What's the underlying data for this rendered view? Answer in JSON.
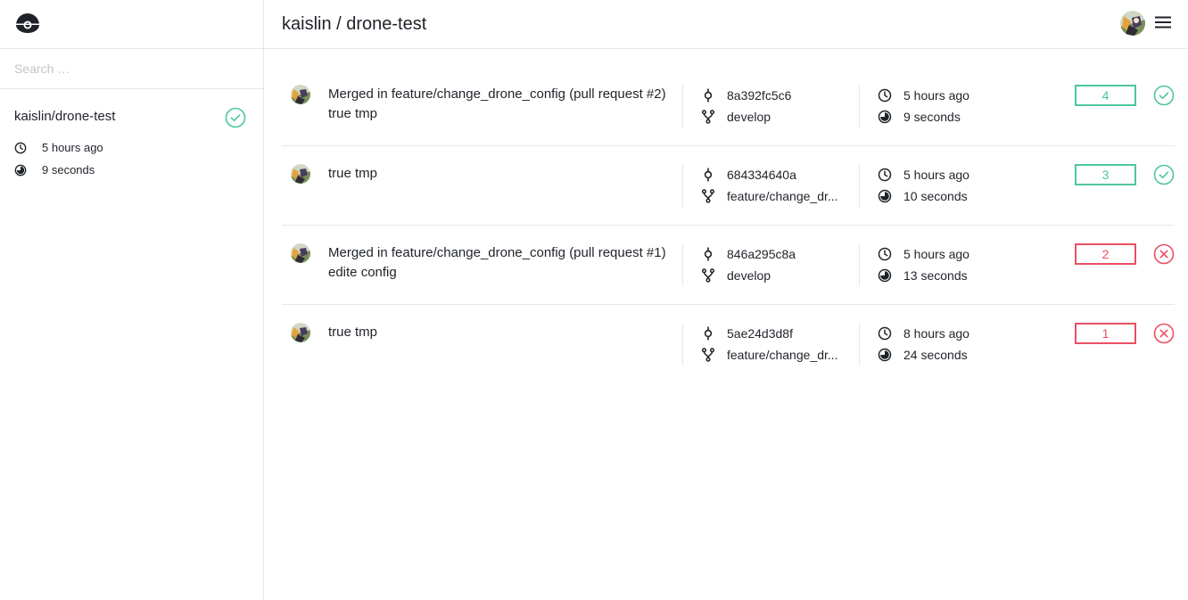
{
  "sidebar": {
    "search_placeholder": "Search …",
    "repo": {
      "name": "kaislin/drone-test",
      "status": "success",
      "time_ago": "5 hours ago",
      "duration": "9 seconds"
    }
  },
  "header": {
    "title": "kaislin / drone-test"
  },
  "builds": [
    {
      "message": "Merged in feature/change_drone_config (pull request #2) true tmp",
      "commit": "8a392fc5c6",
      "branch": "develop",
      "time_ago": "5 hours ago",
      "duration": "9 seconds",
      "number": "4",
      "status": "success"
    },
    {
      "message": "true tmp",
      "commit": "684334640a",
      "branch": "feature/change_dr...",
      "time_ago": "5 hours ago",
      "duration": "10 seconds",
      "number": "3",
      "status": "success"
    },
    {
      "message": "Merged in feature/change_drone_config (pull request #1) edite config",
      "commit": "846a295c8a",
      "branch": "develop",
      "time_ago": "5 hours ago",
      "duration": "13 seconds",
      "number": "2",
      "status": "failure"
    },
    {
      "message": "true tmp",
      "commit": "5ae24d3d8f",
      "branch": "feature/change_dr...",
      "time_ago": "8 hours ago",
      "duration": "24 seconds",
      "number": "1",
      "status": "failure"
    }
  ],
  "colors": {
    "success": "#4cc69d",
    "failure": "#ea4f61",
    "text": "#1f2329",
    "border": "#e6e6e6"
  },
  "icons": {
    "logo": "drone-logo-icon",
    "clock": "clock-icon",
    "duration": "timer-icon",
    "commit": "commit-icon",
    "branch": "branch-icon",
    "success": "check-circle-icon",
    "failure": "x-circle-icon",
    "menu": "hamburger-menu-icon"
  }
}
